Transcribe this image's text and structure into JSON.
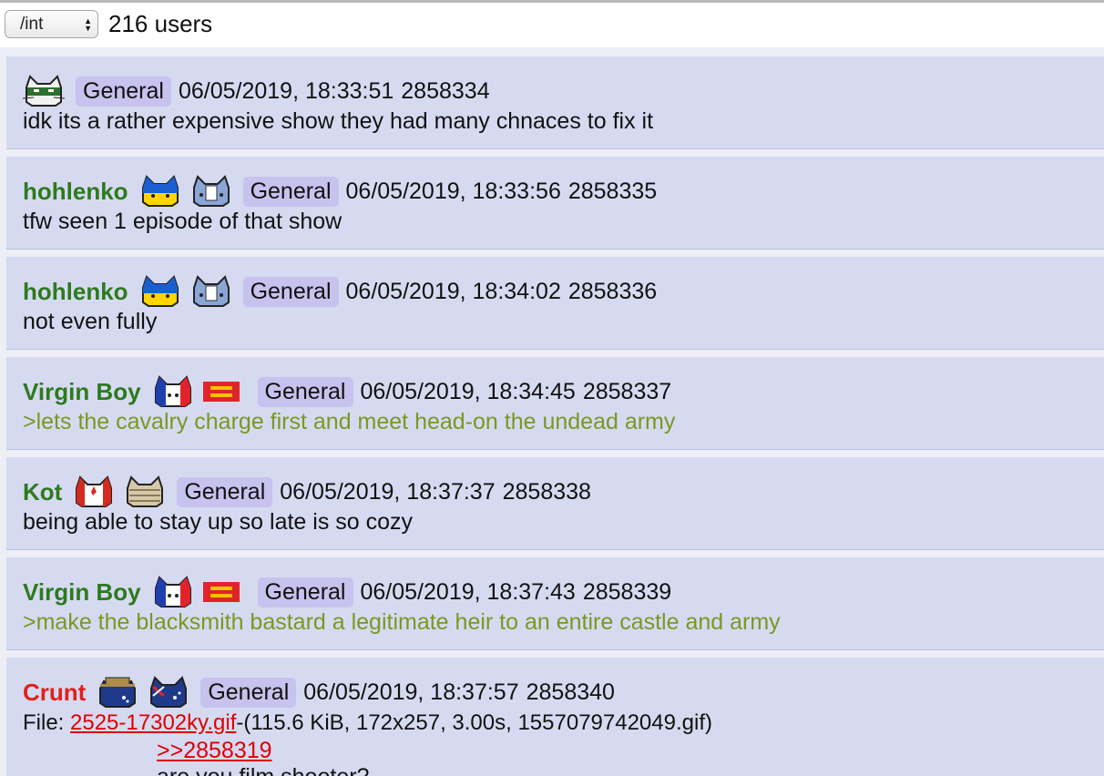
{
  "topbar": {
    "board": "/int",
    "user_count": "216 users"
  },
  "posts": [
    {
      "name": "",
      "icons": [
        "green-mask-cat-icon"
      ],
      "tag": "General",
      "datetime": "06/05/2019, 18:33:51",
      "number": "2858334",
      "text": "idk its a rather expensive show they had many chnaces to fix it",
      "greentext": false
    },
    {
      "name": "hohlenko",
      "icons": [
        "ukraine-cat-icon",
        "blue-cat-icon"
      ],
      "tag": "General",
      "datetime": "06/05/2019, 18:33:56",
      "number": "2858335",
      "text": "tfw seen 1 episode of that show",
      "greentext": false
    },
    {
      "name": "hohlenko",
      "icons": [
        "ukraine-cat-icon",
        "blue-cat-icon"
      ],
      "tag": "General",
      "datetime": "06/05/2019, 18:34:02",
      "number": "2858336",
      "text": "not even fully",
      "greentext": false
    },
    {
      "name": "Virgin Boy",
      "icons": [
        "france-cat-icon",
        "normandy-flag-icon"
      ],
      "tag": "General",
      "datetime": "06/05/2019, 18:34:45",
      "number": "2858337",
      "text": ">lets the cavalry charge first and meet head-on the undead army",
      "greentext": true
    },
    {
      "name": "Kot",
      "icons": [
        "canada-cat-icon",
        "tabby-cat-icon"
      ],
      "tag": "General",
      "datetime": "06/05/2019, 18:37:37",
      "number": "2858338",
      "text": "being able to stay up so late is so cozy",
      "greentext": false
    },
    {
      "name": "Virgin Boy",
      "icons": [
        "france-cat-icon",
        "normandy-flag-icon"
      ],
      "tag": "General",
      "datetime": "06/05/2019, 18:37:43",
      "number": "2858339",
      "text": ">make the blacksmith bastard a legitimate heir to an entire castle and army",
      "greentext": true
    },
    {
      "name": "Crunt",
      "icons": [
        "australia-hat-cat-icon",
        "australia-cat-icon"
      ],
      "tag": "General",
      "datetime": "06/05/2019, 18:37:57",
      "number": "2858340",
      "file_label": "File: ",
      "file_name": "2525-17302ky.gif",
      "file_info": "-(115.6 KiB, 172x257, 3.00s, 1557079742049.gif)",
      "quote": ">>2858319",
      "text": "are you film shooter?"
    }
  ],
  "colors": {
    "post_bg": "#d6daf0",
    "name_green": "#2d7a1e",
    "name_red": "#e3201a",
    "greentext": "#789922",
    "tag_bg": "#c8c2ee",
    "link_red": "#dd0000"
  }
}
